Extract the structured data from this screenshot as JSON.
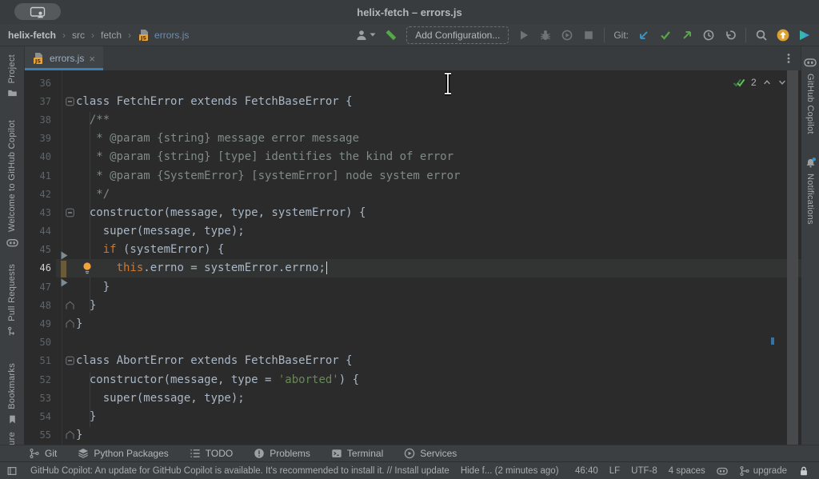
{
  "window": {
    "title": "helix-fetch – errors.js"
  },
  "breadcrumbs": {
    "separator": "›",
    "items": [
      {
        "label": "helix-fetch"
      },
      {
        "label": "src"
      },
      {
        "label": "fetch"
      },
      {
        "label": "errors.js"
      }
    ]
  },
  "toolbar": {
    "add_configuration_label": "Add Configuration...",
    "git_label": "Git:"
  },
  "tab_bar": {
    "tabs": [
      {
        "label": "errors.js"
      }
    ],
    "close_glyph": "×"
  },
  "left_strip": {
    "items": [
      {
        "label": "Project"
      },
      {
        "label": "Welcome to GitHub Copilot"
      },
      {
        "label": "Pull Requests"
      },
      {
        "label": "Bookmarks"
      }
    ],
    "partial_bottom_label": "ure"
  },
  "right_strip": {
    "items": [
      {
        "label": "GitHub Copilot"
      },
      {
        "label": "Notifications"
      }
    ]
  },
  "editor": {
    "inspections_count": "2",
    "caret_line": 46,
    "lines": [
      {
        "n": 36,
        "fold": null,
        "segs": []
      },
      {
        "n": 37,
        "fold": "collapse",
        "segs": [
          [
            "class FetchError extends FetchBaseError {",
            "d"
          ]
        ]
      },
      {
        "n": 38,
        "fold": null,
        "segs": [
          [
            "  /**",
            "c"
          ]
        ]
      },
      {
        "n": 39,
        "fold": null,
        "segs": [
          [
            "   * @param {string} message error message",
            "c"
          ]
        ]
      },
      {
        "n": 40,
        "fold": null,
        "segs": [
          [
            "   * @param {string} [type] identifies the kind of error",
            "c"
          ]
        ]
      },
      {
        "n": 41,
        "fold": null,
        "segs": [
          [
            "   * @param {SystemError} [systemError] node system error",
            "c"
          ]
        ]
      },
      {
        "n": 42,
        "fold": null,
        "segs": [
          [
            "   */",
            "c"
          ]
        ]
      },
      {
        "n": 43,
        "fold": "collapse",
        "segs": [
          [
            "  constructor(message, type, systemError) {",
            "d"
          ]
        ]
      },
      {
        "n": 44,
        "fold": null,
        "segs": [
          [
            "    super(message, type);",
            "d"
          ]
        ]
      },
      {
        "n": 45,
        "fold": null,
        "segs": [
          [
            "    ",
            "d"
          ],
          [
            "if",
            "k"
          ],
          [
            " (systemError) {",
            "d"
          ]
        ]
      },
      {
        "n": 46,
        "fold": null,
        "cur": true,
        "bulb": true,
        "segs": [
          [
            "      ",
            "d"
          ],
          [
            "this",
            "k"
          ],
          [
            ".errno = systemError.errno;",
            "d"
          ]
        ]
      },
      {
        "n": 47,
        "fold": null,
        "segs": [
          [
            "    }",
            "d"
          ]
        ]
      },
      {
        "n": 48,
        "fold": "end",
        "segs": [
          [
            "  }",
            "d"
          ]
        ]
      },
      {
        "n": 49,
        "fold": "end",
        "segs": [
          [
            "}",
            "d"
          ]
        ]
      },
      {
        "n": 50,
        "fold": null,
        "segs": []
      },
      {
        "n": 51,
        "fold": "collapse",
        "segs": [
          [
            "class AbortError extends FetchBaseError {",
            "d"
          ]
        ]
      },
      {
        "n": 52,
        "fold": null,
        "segs": [
          [
            "  constructor(message, type = ",
            "d"
          ],
          [
            "'aborted'",
            "s"
          ],
          [
            ") {",
            "d"
          ]
        ]
      },
      {
        "n": 53,
        "fold": null,
        "segs": [
          [
            "    super(message, type);",
            "d"
          ]
        ]
      },
      {
        "n": 54,
        "fold": null,
        "segs": [
          [
            "  }",
            "d"
          ]
        ]
      },
      {
        "n": 55,
        "fold": "end",
        "segs": [
          [
            "}",
            "d"
          ]
        ]
      }
    ]
  },
  "bottom_bar": {
    "items": [
      {
        "label": "Git"
      },
      {
        "label": "Python Packages"
      },
      {
        "label": "TODO"
      },
      {
        "label": "Problems"
      },
      {
        "label": "Terminal"
      },
      {
        "label": "Services"
      }
    ]
  },
  "status_bar": {
    "message": "GitHub Copilot: An update for GitHub Copilot is available. It's recommended to install it. // Install update",
    "hide_label": "Hide f... (2 minutes ago)",
    "position": "46:40",
    "line_ending": "LF",
    "encoding": "UTF-8",
    "indent": "4 spaces",
    "upgrade_label": "upgrade"
  },
  "colors": {
    "tab_underline": "#3a80b6",
    "keyword": "#cc7832",
    "string": "#6a8759",
    "comment": "#7f8b84",
    "code_default": "#a9b7c6",
    "editor_bg": "#2b2b2b",
    "chrome_bg": "#3c3f41",
    "bulb": "#f2a33c",
    "git_green": "#57a64a",
    "git_blue": "#3592c4",
    "update_orange": "#dda032"
  }
}
